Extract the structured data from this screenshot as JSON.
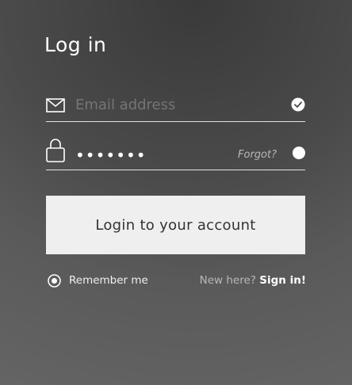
{
  "login": {
    "title": "Log in",
    "email": {
      "placeholder": "Email address",
      "icon": "mail-icon",
      "status_icon": "check-circle-icon"
    },
    "password": {
      "masked_value": "•••••••",
      "icon": "lock-icon",
      "forgot_label": "Forgot?",
      "status_icon": "radio-dot-icon"
    },
    "submit_label": "Login to your account",
    "remember": {
      "label": "Remember me",
      "icon": "radio-selected-icon",
      "checked": true
    },
    "signup": {
      "prompt": "New here?",
      "link_label": "Sign in!"
    }
  },
  "colors": {
    "background_top": "#3a3a3a",
    "background_bottom": "#676767",
    "button_bg": "#efefef",
    "button_text": "#333333",
    "muted_text": "#b8b8b8",
    "text": "#ffffff"
  }
}
